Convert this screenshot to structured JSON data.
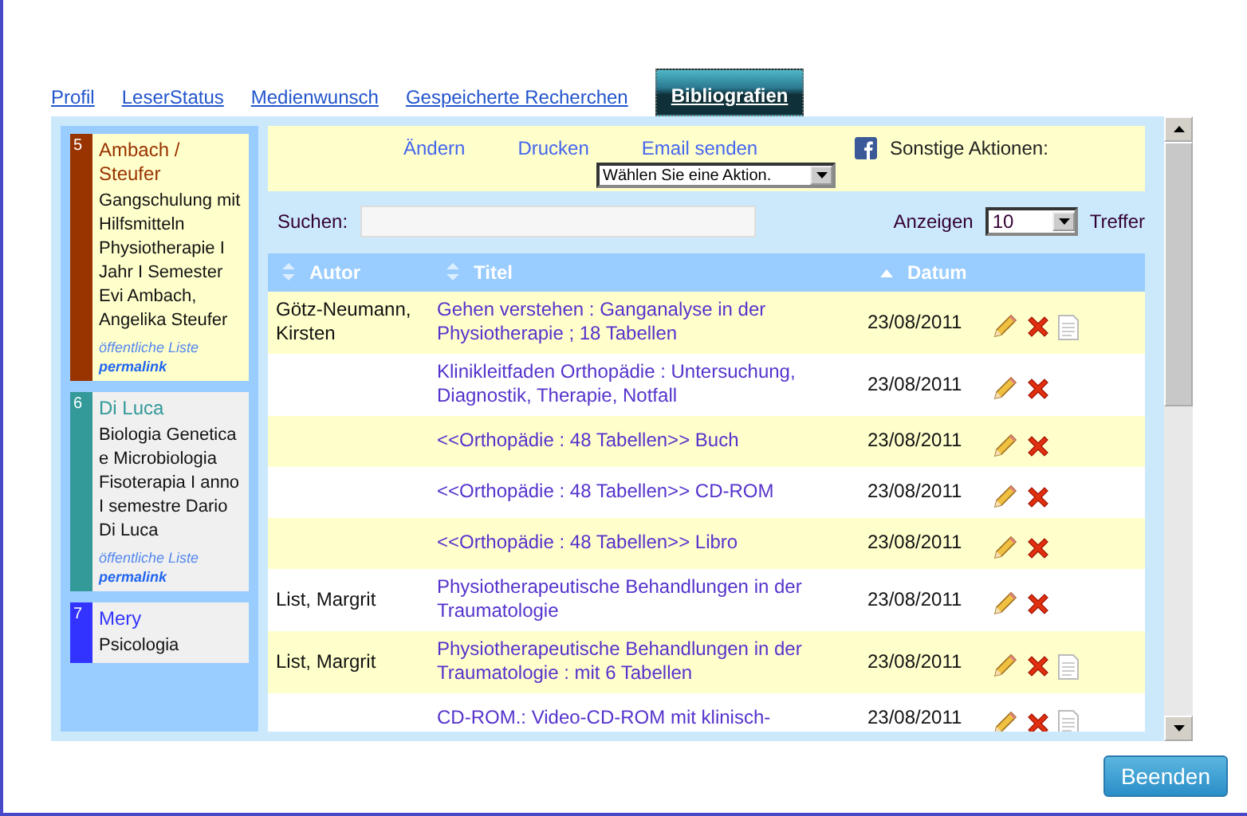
{
  "tabs": [
    {
      "label": "Profil",
      "selected": false
    },
    {
      "label": "LeserStatus",
      "selected": false
    },
    {
      "label": "Medienwunsch",
      "selected": false
    },
    {
      "label": "Gespeicherte Recherchen",
      "selected": false
    },
    {
      "label": "Bibliografien",
      "selected": true
    }
  ],
  "lists": [
    {
      "number": "5",
      "name": "Ambach / Steufer",
      "description": "Gangschulung mit Hilfsmitteln Physiotherapie I Jahr I Semester Evi Ambach, Angelika Steufer",
      "visibility": "öffentliche Liste",
      "permalink": "permalink",
      "color": "#993300",
      "selected": true
    },
    {
      "number": "6",
      "name": "Di Luca",
      "description": "Biologia Genetica e Microbiologia Fisoterapia I anno I semestre Dario Di Luca",
      "visibility": "öffentliche Liste",
      "permalink": "permalink",
      "color": "#339999",
      "selected": false
    },
    {
      "number": "7",
      "name": "Mery",
      "description": "Psicologia",
      "color": "#3333ff",
      "selected": false
    }
  ],
  "actions": {
    "links": [
      "Ändern",
      "Drucken",
      "Email senden"
    ],
    "other_label": "Sonstige Aktionen:",
    "select": "Wählen Sie eine Aktion."
  },
  "search": {
    "label": "Suchen:"
  },
  "page_size": {
    "label": "Anzeigen",
    "value": "10",
    "suffix": "Treffer"
  },
  "table": {
    "columns": [
      {
        "label": "Autor",
        "sorted_ascending": false
      },
      {
        "label": "Titel",
        "sorted_ascending": false
      },
      {
        "label": "Datum",
        "sorted_ascending": true
      }
    ],
    "rows": [
      {
        "author": "Götz-Neumann, Kirsten",
        "title": "Gehen verstehen : Ganganalyse in der Physiotherapie ; 18 Tabellen",
        "date": "23/08/2011",
        "has_note": true
      },
      {
        "title": "Klinikleitfaden Orthopädie : Untersuchung, Diagnostik, Therapie, Notfall",
        "date": "23/08/2011",
        "has_note": false
      },
      {
        "title": "<<Orthopädie : 48 Tabellen>> Buch",
        "date": "23/08/2011",
        "has_note": false
      },
      {
        "title": "<<Orthopädie : 48 Tabellen>> CD-ROM",
        "date": "23/08/2011",
        "has_note": false
      },
      {
        "title": "<<Orthopädie : 48 Tabellen>> Libro",
        "date": "23/08/2011",
        "has_note": false
      },
      {
        "author": "List, Margrit",
        "title": "Physiotherapeutische Behandlungen in der Traumatologie",
        "date": "23/08/2011",
        "has_note": false
      },
      {
        "author": "List, Margrit",
        "title": "Physiotherapeutische Behandlungen in der Traumatologie : mit 6 Tabellen",
        "date": "23/08/2011",
        "has_note": true
      },
      {
        "title": "CD-ROM.: Video-CD-ROM mit klinisch-",
        "date": "23/08/2011",
        "has_note": true
      }
    ]
  },
  "close_button": "Beenden"
}
